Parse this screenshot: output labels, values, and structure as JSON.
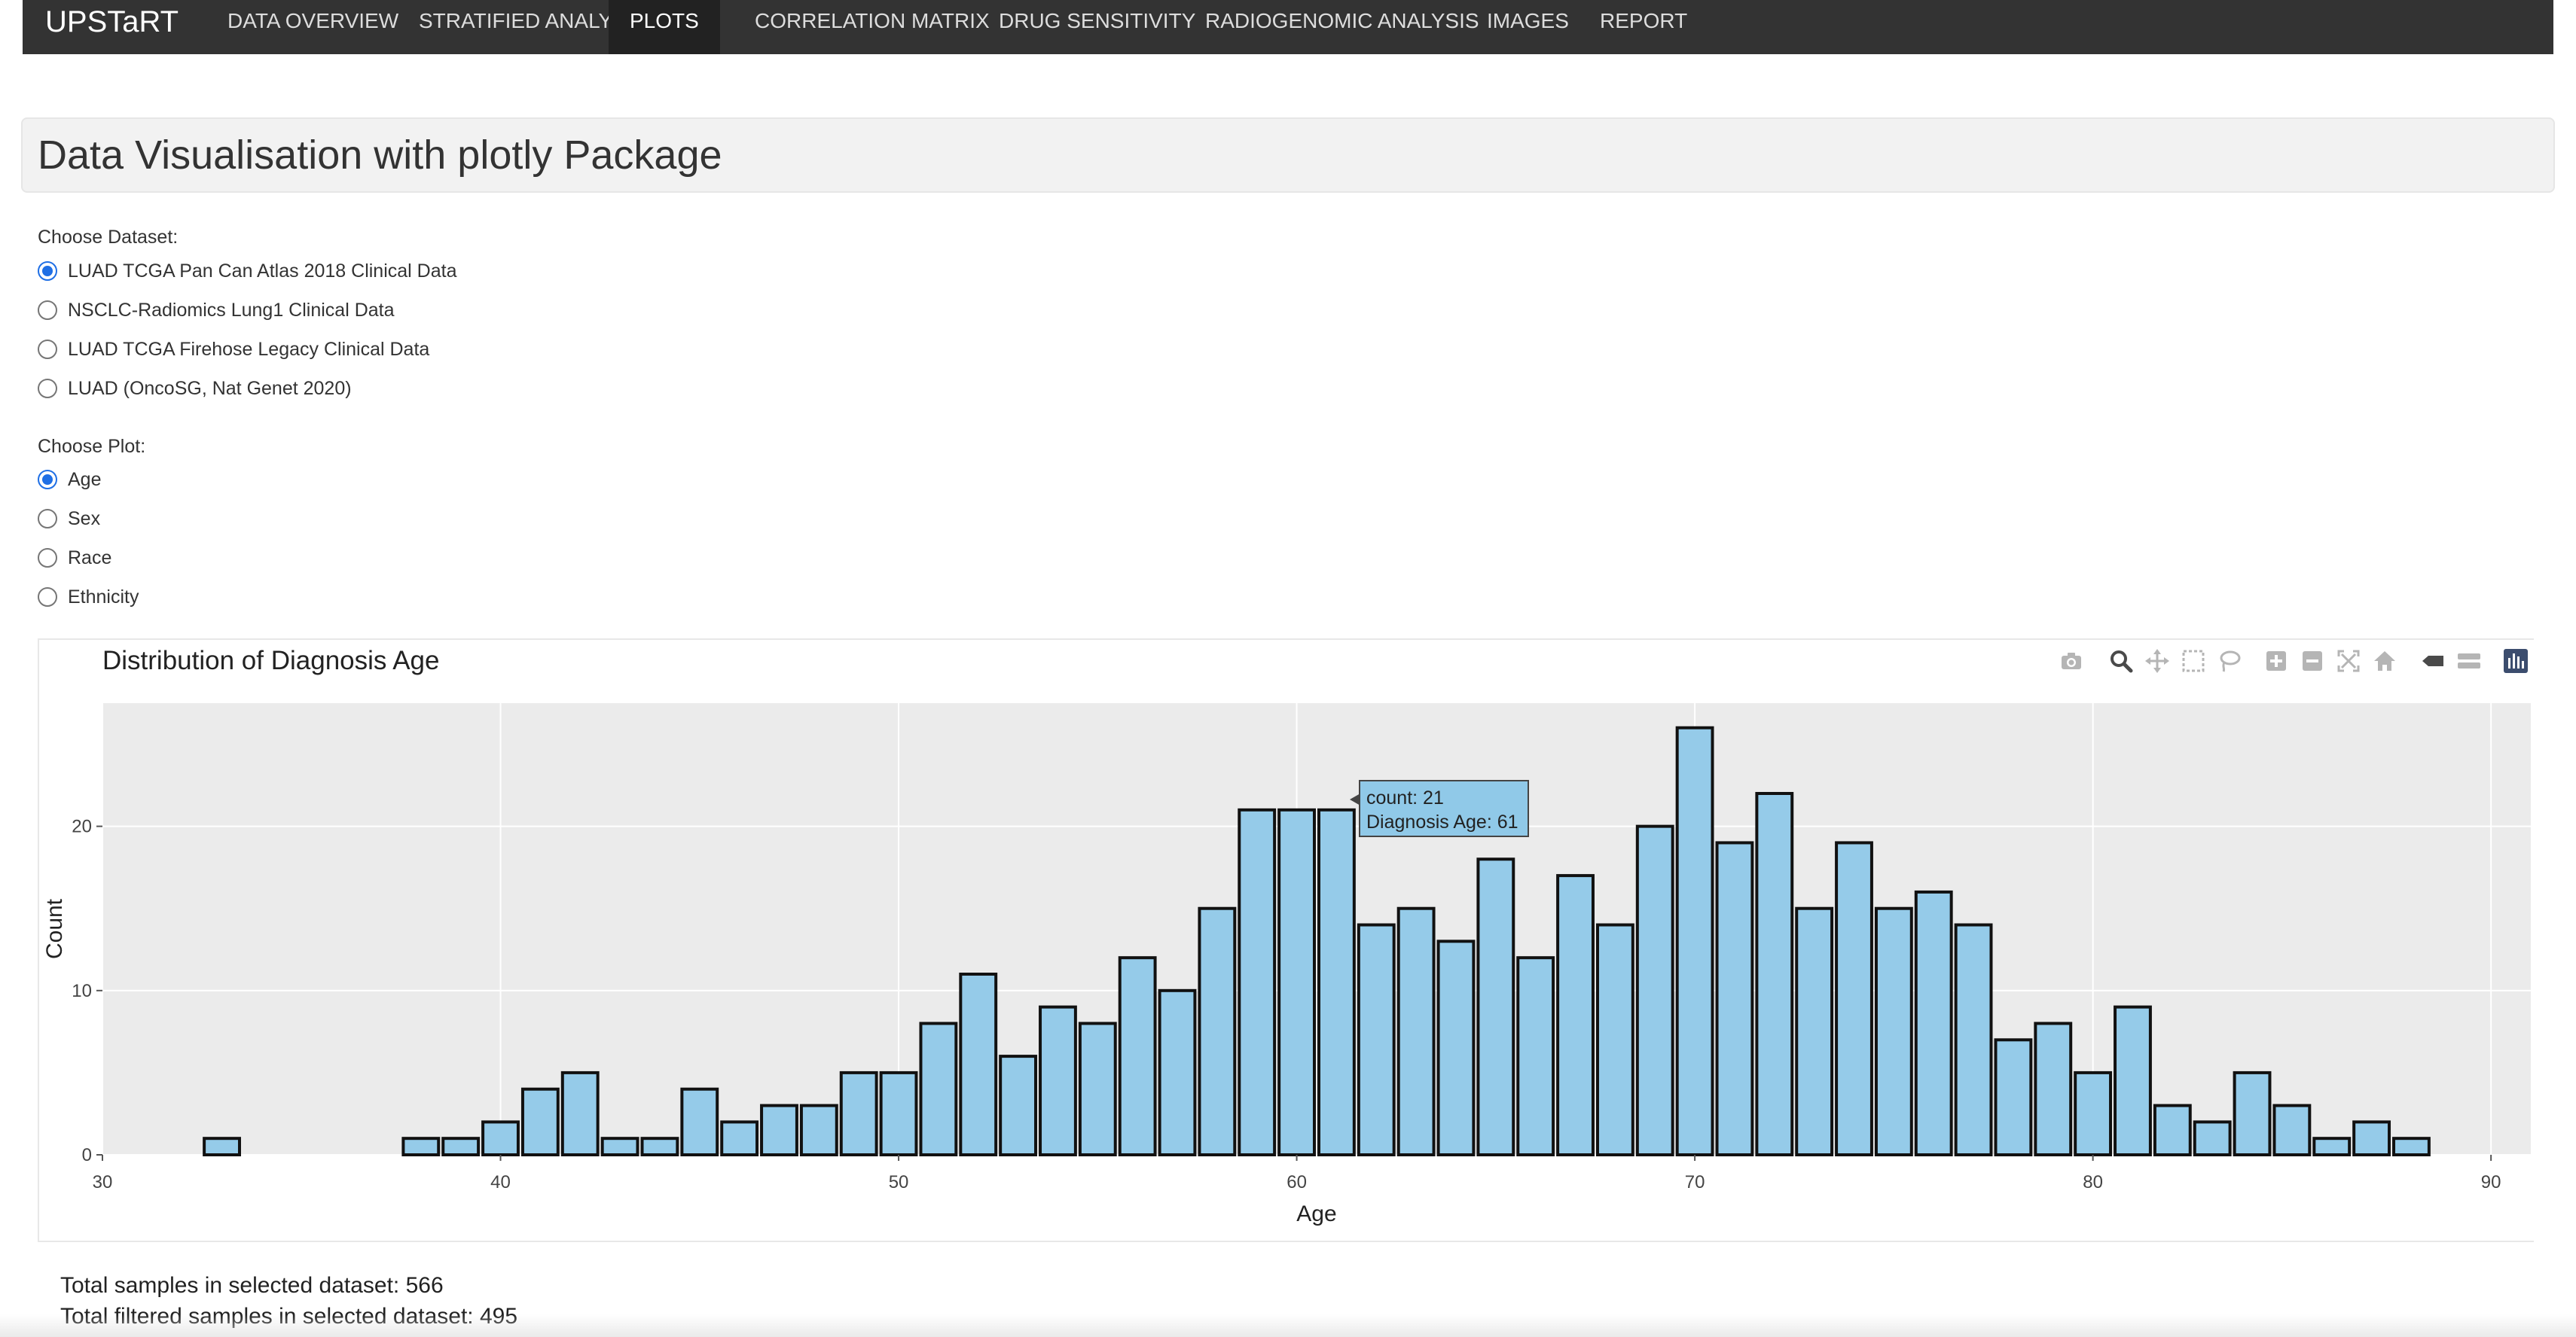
{
  "nav": {
    "brand": "UPSTaRT",
    "items": [
      {
        "label": "DATA OVERVIEW",
        "active": false
      },
      {
        "label": "STRATIFIED ANALYSIS",
        "active": false
      },
      {
        "label": "PLOTS",
        "active": true
      },
      {
        "label": "CORRELATION MATRIX",
        "active": false
      },
      {
        "label": "DRUG SENSITIVITY",
        "active": false
      },
      {
        "label": "RADIOGENOMIC ANALYSIS",
        "active": false
      },
      {
        "label": "IMAGES",
        "active": false
      },
      {
        "label": "REPORT",
        "active": false
      }
    ]
  },
  "page": {
    "title": "Data Visualisation with plotly Package"
  },
  "dataset_selector": {
    "label": "Choose Dataset:",
    "options": [
      {
        "label": "LUAD TCGA Pan Can Atlas 2018 Clinical Data",
        "checked": true
      },
      {
        "label": "NSCLC-Radiomics Lung1 Clinical Data",
        "checked": false
      },
      {
        "label": "LUAD TCGA Firehose Legacy Clinical Data",
        "checked": false
      },
      {
        "label": "LUAD (OncoSG, Nat Genet 2020)",
        "checked": false
      }
    ]
  },
  "plot_selector": {
    "label": "Choose Plot:",
    "options": [
      {
        "label": "Age",
        "checked": true
      },
      {
        "label": "Sex",
        "checked": false
      },
      {
        "label": "Race",
        "checked": false
      },
      {
        "label": "Ethnicity",
        "checked": false
      }
    ]
  },
  "modebar": {
    "icons": [
      "camera-icon",
      "zoom-icon",
      "pan-icon",
      "box-select-icon",
      "lasso-icon",
      "zoom-in-icon",
      "zoom-out-icon",
      "autoscale-icon",
      "reset-axes-icon",
      "hover-closest-icon",
      "hover-compare-icon",
      "plotly-logo-icon"
    ]
  },
  "tooltip": {
    "line1": "count: 21",
    "line2": "Diagnosis Age: 61"
  },
  "summary": {
    "total": "Total samples in selected dataset: 566",
    "filtered": "Total filtered samples in selected dataset: 495"
  },
  "colors": {
    "bar_fill": "#95cbe9",
    "bar_stroke": "#111111",
    "plot_bg": "#ebebeb",
    "navbar_bg": "#333333",
    "radio_accent": "#1f6fe5",
    "modebar_active": "#3c4d6e"
  },
  "chart_data": {
    "type": "bar",
    "title": "Distribution of Diagnosis Age",
    "xlabel": "Age",
    "ylabel": "Count",
    "xlim": [
      30,
      91
    ],
    "ylim": [
      0,
      27.5
    ],
    "bin_width": 1,
    "x_ticks": [
      30,
      40,
      50,
      60,
      70,
      80,
      90
    ],
    "y_ticks": [
      0,
      10,
      20
    ],
    "grid": true,
    "bins": [
      {
        "x": 33,
        "count": 1
      },
      {
        "x": 38,
        "count": 1
      },
      {
        "x": 39,
        "count": 1
      },
      {
        "x": 40,
        "count": 2
      },
      {
        "x": 41,
        "count": 4
      },
      {
        "x": 42,
        "count": 5
      },
      {
        "x": 43,
        "count": 1
      },
      {
        "x": 44,
        "count": 1
      },
      {
        "x": 45,
        "count": 4
      },
      {
        "x": 46,
        "count": 2
      },
      {
        "x": 47,
        "count": 3
      },
      {
        "x": 48,
        "count": 3
      },
      {
        "x": 49,
        "count": 5
      },
      {
        "x": 50,
        "count": 5
      },
      {
        "x": 51,
        "count": 8
      },
      {
        "x": 52,
        "count": 11
      },
      {
        "x": 53,
        "count": 6
      },
      {
        "x": 54,
        "count": 9
      },
      {
        "x": 55,
        "count": 8
      },
      {
        "x": 56,
        "count": 12
      },
      {
        "x": 57,
        "count": 10
      },
      {
        "x": 58,
        "count": 15
      },
      {
        "x": 59,
        "count": 21
      },
      {
        "x": 60,
        "count": 21
      },
      {
        "x": 61,
        "count": 21
      },
      {
        "x": 62,
        "count": 14
      },
      {
        "x": 63,
        "count": 15
      },
      {
        "x": 64,
        "count": 13
      },
      {
        "x": 65,
        "count": 18
      },
      {
        "x": 66,
        "count": 12
      },
      {
        "x": 67,
        "count": 17
      },
      {
        "x": 68,
        "count": 14
      },
      {
        "x": 69,
        "count": 20
      },
      {
        "x": 70,
        "count": 26
      },
      {
        "x": 71,
        "count": 19
      },
      {
        "x": 72,
        "count": 22
      },
      {
        "x": 73,
        "count": 15
      },
      {
        "x": 74,
        "count": 19
      },
      {
        "x": 75,
        "count": 15
      },
      {
        "x": 76,
        "count": 16
      },
      {
        "x": 77,
        "count": 14
      },
      {
        "x": 78,
        "count": 7
      },
      {
        "x": 79,
        "count": 8
      },
      {
        "x": 80,
        "count": 5
      },
      {
        "x": 81,
        "count": 9
      },
      {
        "x": 82,
        "count": 3
      },
      {
        "x": 83,
        "count": 2
      },
      {
        "x": 84,
        "count": 5
      },
      {
        "x": 85,
        "count": 3
      },
      {
        "x": 86,
        "count": 1
      },
      {
        "x": 87,
        "count": 2
      },
      {
        "x": 88,
        "count": 1
      }
    ]
  }
}
